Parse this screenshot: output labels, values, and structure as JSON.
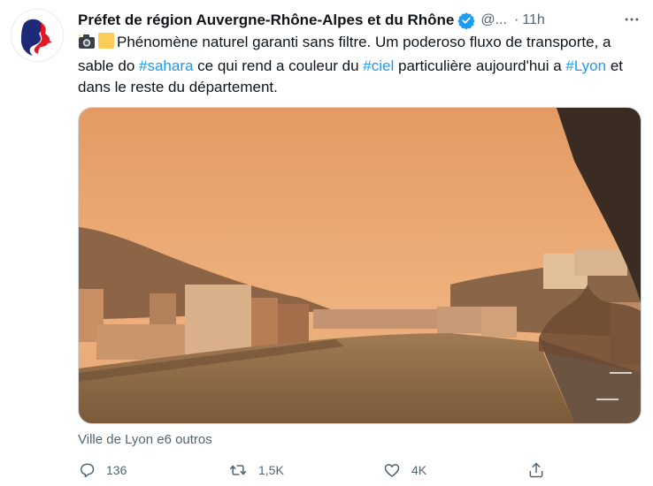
{
  "tweet": {
    "author_name": "Préfet de région Auvergne-Rhône-Alpes et du Rhône",
    "handle": "@...",
    "separator": "·",
    "time": "11h",
    "text_before_1": "Phénomène naturel garanti sans filtre. Um poderoso fluxo de transporte, a sable do ",
    "hashtag_1": "#sahara",
    "text_before_2": " ce qui rend a couleur du ",
    "hashtag_2": "#ciel",
    "text_before_3": " particulière aujourd'hui a ",
    "hashtag_3": "#Lyon",
    "text_after": " et dans le reste du département.",
    "emojis": [
      "camera-flash-emoji",
      "yellow-square-emoji"
    ],
    "media_icon": "orange-sky-river-city-photo",
    "tagged": "Ville de Lyon e6 outros"
  },
  "actions": {
    "reply_count": "136",
    "retweet_count": "1,5K",
    "like_count": "4K"
  },
  "colors": {
    "text": "#0f1419",
    "secondary": "#536471",
    "accent": "#1d9bf0",
    "sky": "#e9a46e",
    "river": "#8a6a47"
  }
}
